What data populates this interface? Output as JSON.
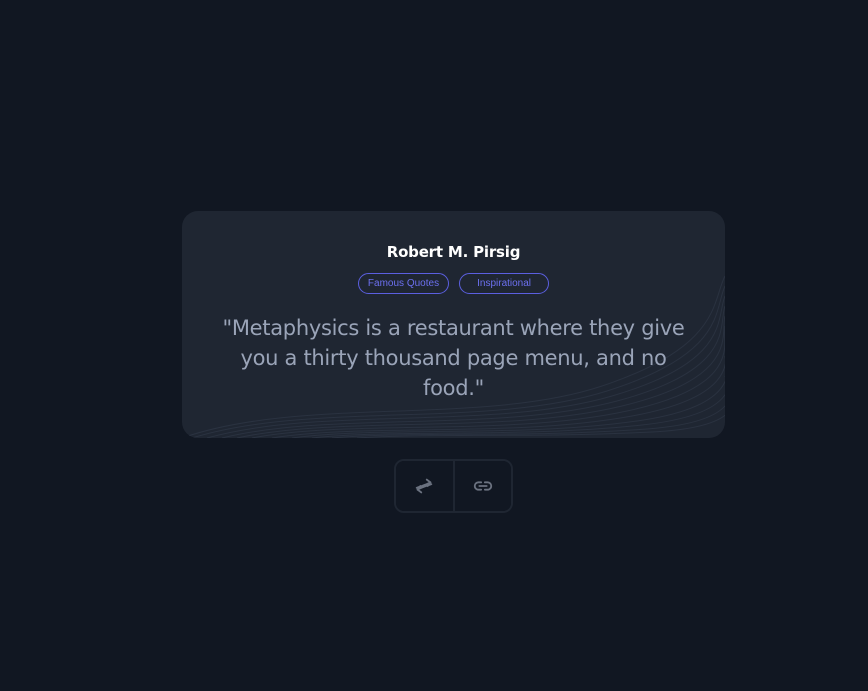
{
  "quote_card": {
    "author": "Robert M. Pirsig",
    "tags": [
      "Famous Quotes",
      "Inspirational"
    ],
    "text": "\"Metaphysics is a restaurant where they give you a thirty thousand page menu, and no food.\""
  },
  "actions": {
    "new_quote_icon": "swap-arrows-icon",
    "copy_link_icon": "link-icon"
  },
  "colors": {
    "background": "#111722",
    "card": "#1f2632",
    "tag_accent": "#5b5fe0",
    "quote_text": "#9aa4b8",
    "author_text": "#ffffff",
    "icon": "#6b7280"
  }
}
